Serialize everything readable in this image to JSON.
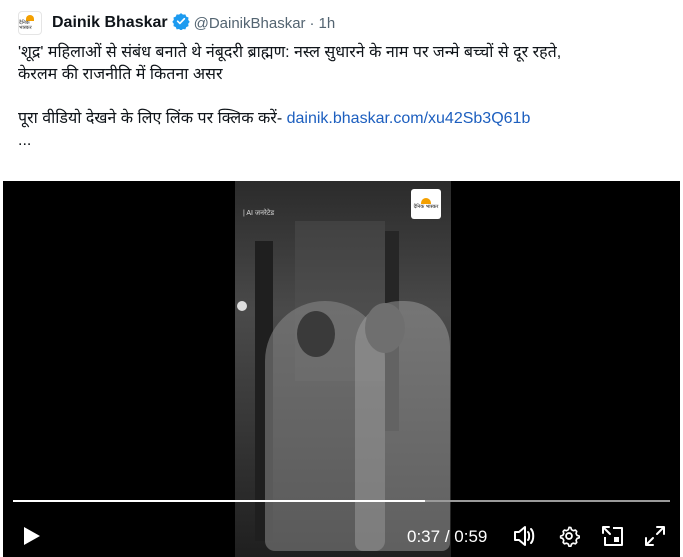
{
  "tweet": {
    "avatar_text": "दैनिक भास्कर",
    "author_name": "Dainik Bhaskar",
    "handle": "@DainikBhaskar",
    "separator": "·",
    "time": "1h",
    "text_line1": "'शूद्र' महिलाओं से संबंध बनाते थे नंबूदरी ब्राह्मण: नस्ल सुधारने के नाम पर जन्मे बच्चों से दूर रहते,",
    "text_line2": "केरलम की राजनीति में कितना असर",
    "text_line3": "पूरा वीडियो देखने के लिए लिंक पर क्लिक करें-",
    "link": "dainik.bhaskar.com/xu42Sb3Q61b",
    "ellipsis": "..."
  },
  "video": {
    "watermark": "| AI जनरेटेड",
    "logo_text": "दैनिक भास्कर",
    "current_time": "0:37",
    "duration": "0:59",
    "time_separator": " / ",
    "progress_fraction": 0.627
  },
  "icons": {
    "play": "play-icon",
    "volume": "volume-icon",
    "settings": "settings-gear-icon",
    "pip": "picture-in-picture-icon",
    "fullscreen": "fullscreen-icon"
  },
  "colors": {
    "link": "#1d5fbf",
    "verified": "#1d9bf0",
    "muted": "#536471",
    "brand": "#f4a000"
  }
}
